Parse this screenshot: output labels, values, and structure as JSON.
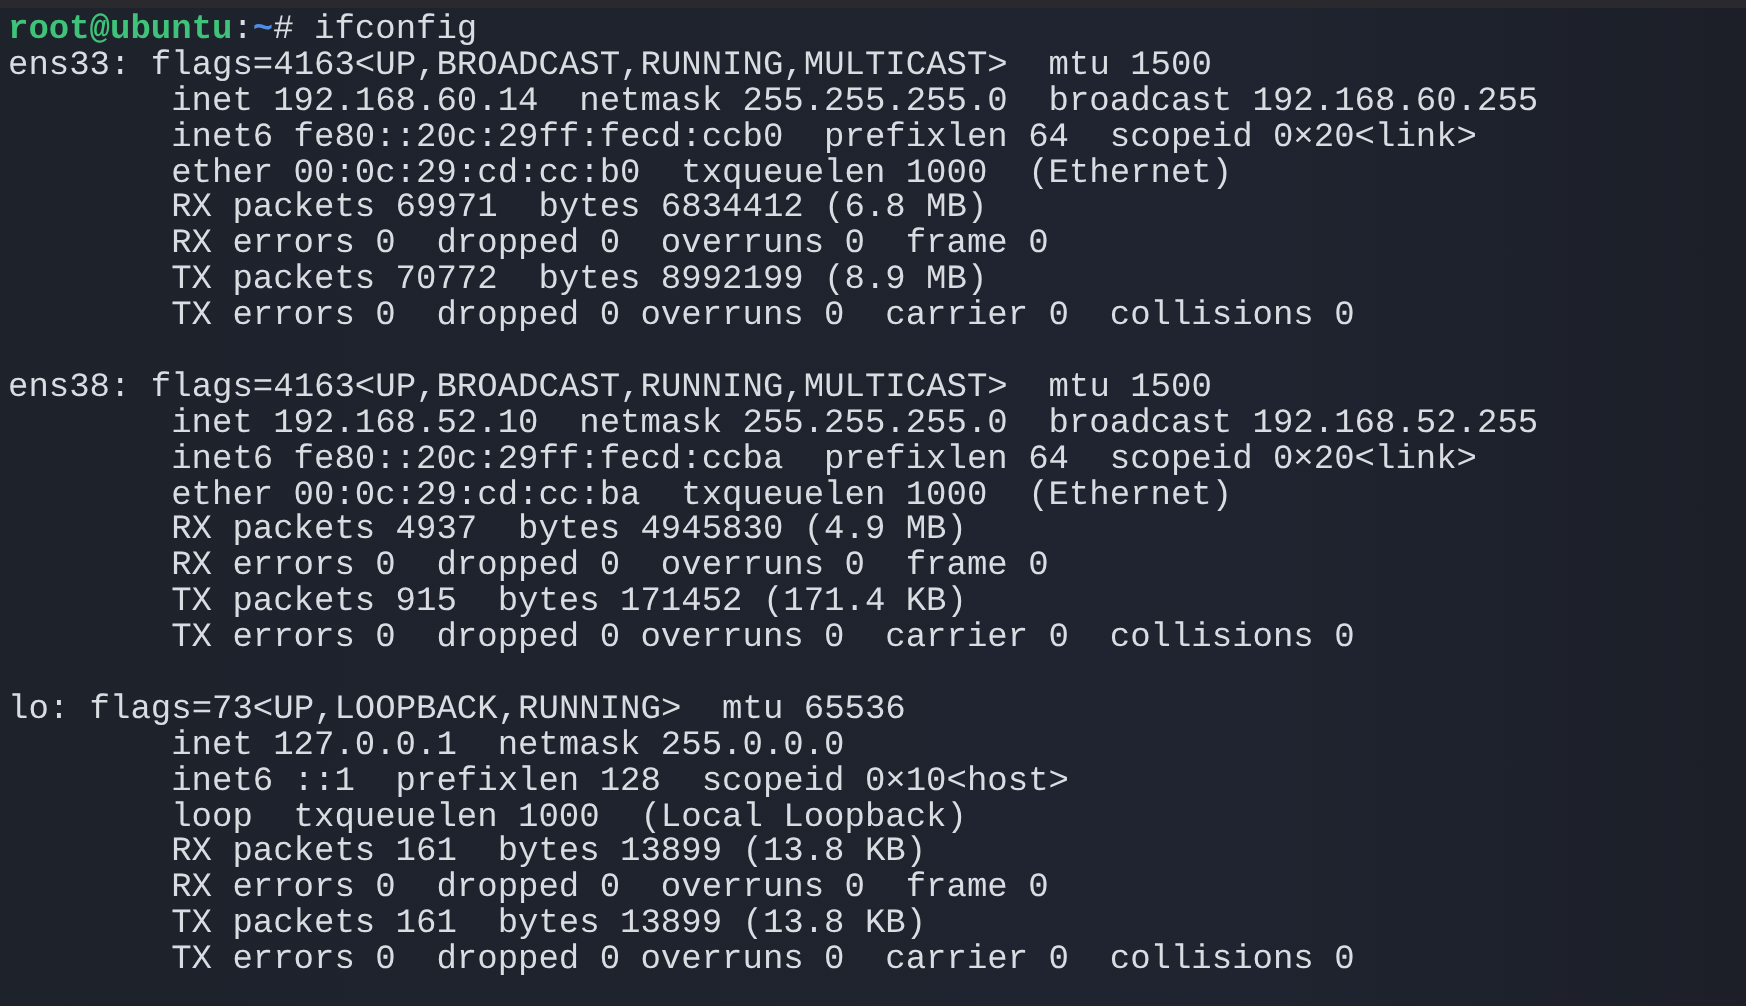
{
  "prompt": {
    "user_host": "root@ubuntu",
    "separator": ":",
    "path": "~",
    "symbol": "#",
    "command": "ifconfig"
  },
  "interfaces": [
    {
      "header": "ens33: flags=4163<UP,BROADCAST,RUNNING,MULTICAST>  mtu 1500",
      "lines": [
        "inet 192.168.60.14  netmask 255.255.255.0  broadcast 192.168.60.255",
        "inet6 fe80::20c:29ff:fecd:ccb0  prefixlen 64  scopeid 0×20<link>",
        "ether 00:0c:29:cd:cc:b0  txqueuelen 1000  (Ethernet)",
        "RX packets 69971  bytes 6834412 (6.8 MB)",
        "RX errors 0  dropped 0  overruns 0  frame 0",
        "TX packets 70772  bytes 8992199 (8.9 MB)",
        "TX errors 0  dropped 0 overruns 0  carrier 0  collisions 0"
      ]
    },
    {
      "header": "ens38: flags=4163<UP,BROADCAST,RUNNING,MULTICAST>  mtu 1500",
      "lines": [
        "inet 192.168.52.10  netmask 255.255.255.0  broadcast 192.168.52.255",
        "inet6 fe80::20c:29ff:fecd:ccba  prefixlen 64  scopeid 0×20<link>",
        "ether 00:0c:29:cd:cc:ba  txqueuelen 1000  (Ethernet)",
        "RX packets 4937  bytes 4945830 (4.9 MB)",
        "RX errors 0  dropped 0  overruns 0  frame 0",
        "TX packets 915  bytes 171452 (171.4 KB)",
        "TX errors 0  dropped 0 overruns 0  carrier 0  collisions 0"
      ]
    },
    {
      "header": "lo: flags=73<UP,LOOPBACK,RUNNING>  mtu 65536",
      "lines": [
        "inet 127.0.0.1  netmask 255.0.0.0",
        "inet6 ::1  prefixlen 128  scopeid 0×10<host>",
        "loop  txqueuelen 1000  (Local Loopback)",
        "RX packets 161  bytes 13899 (13.8 KB)",
        "RX errors 0  dropped 0  overruns 0  frame 0",
        "TX packets 161  bytes 13899 (13.8 KB)",
        "TX errors 0  dropped 0 overruns 0  carrier 0  collisions 0"
      ]
    }
  ]
}
